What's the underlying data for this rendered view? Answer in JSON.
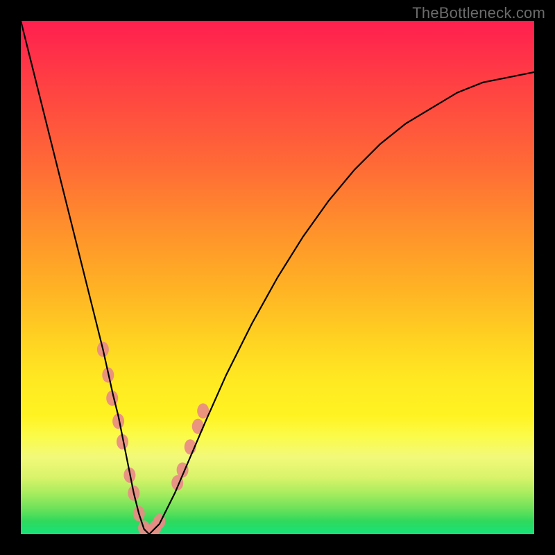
{
  "watermark": "TheBottleneck.com",
  "chart_data": {
    "type": "line",
    "title": "",
    "xlabel": "",
    "ylabel": "",
    "xlim": [
      0,
      100
    ],
    "ylim": [
      0,
      100
    ],
    "x": [
      0,
      2,
      4,
      6,
      8,
      10,
      12,
      14,
      16,
      18,
      19,
      20,
      21,
      22,
      23,
      24,
      25,
      27,
      30,
      33,
      36,
      40,
      45,
      50,
      55,
      60,
      65,
      70,
      75,
      80,
      85,
      90,
      95,
      100
    ],
    "values": [
      100,
      92,
      84,
      76,
      68,
      60,
      52,
      44,
      36,
      27,
      23,
      18,
      13,
      8,
      4,
      1,
      0,
      2,
      8,
      15,
      22,
      31,
      41,
      50,
      58,
      65,
      71,
      76,
      80,
      83,
      86,
      88,
      89,
      90
    ],
    "minimum_x": 24.5,
    "markers": {
      "comment": "pink marker clusters near valley (approx positions along curve)",
      "points_xy": [
        [
          16.0,
          36.0
        ],
        [
          17.0,
          31.0
        ],
        [
          17.8,
          26.5
        ],
        [
          19.0,
          22.0
        ],
        [
          19.8,
          18.0
        ],
        [
          21.2,
          11.5
        ],
        [
          22.0,
          8.0
        ],
        [
          23.0,
          4.0
        ],
        [
          24.0,
          1.2
        ],
        [
          25.0,
          0.4
        ],
        [
          26.2,
          1.3
        ],
        [
          27.0,
          2.5
        ],
        [
          30.5,
          10.0
        ],
        [
          31.5,
          12.5
        ],
        [
          33.0,
          17.0
        ],
        [
          34.5,
          21.0
        ],
        [
          35.5,
          24.0
        ]
      ]
    }
  }
}
